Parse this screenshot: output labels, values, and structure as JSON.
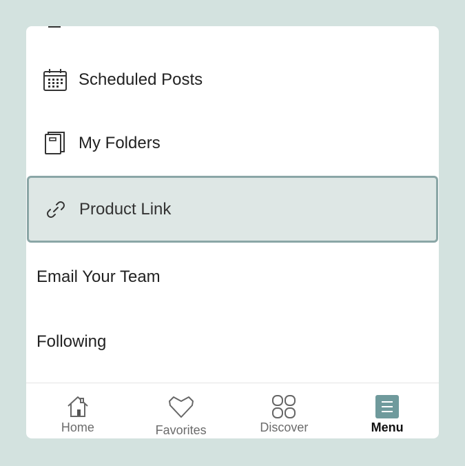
{
  "menu": {
    "items": [
      {
        "label": "Scheduled Posts",
        "icon": "calendar-icon"
      },
      {
        "label": "My Folders",
        "icon": "folder-icon"
      },
      {
        "label": "Product Link",
        "icon": "link-icon",
        "selected": true
      },
      {
        "label": "Email Your Team"
      },
      {
        "label": "Following"
      }
    ]
  },
  "tabbar": {
    "tabs": [
      {
        "label": "Home",
        "icon": "home-icon"
      },
      {
        "label": "Favorites",
        "icon": "heart-icon"
      },
      {
        "label": "Discover",
        "icon": "grid-icon"
      },
      {
        "label": "Menu",
        "icon": "menu-icon",
        "active": true
      }
    ]
  },
  "colors": {
    "background": "#d3e2df",
    "selected_fill": "#dee7e5",
    "selected_border": "#8aa6a6",
    "accent": "#6f9a9c"
  }
}
